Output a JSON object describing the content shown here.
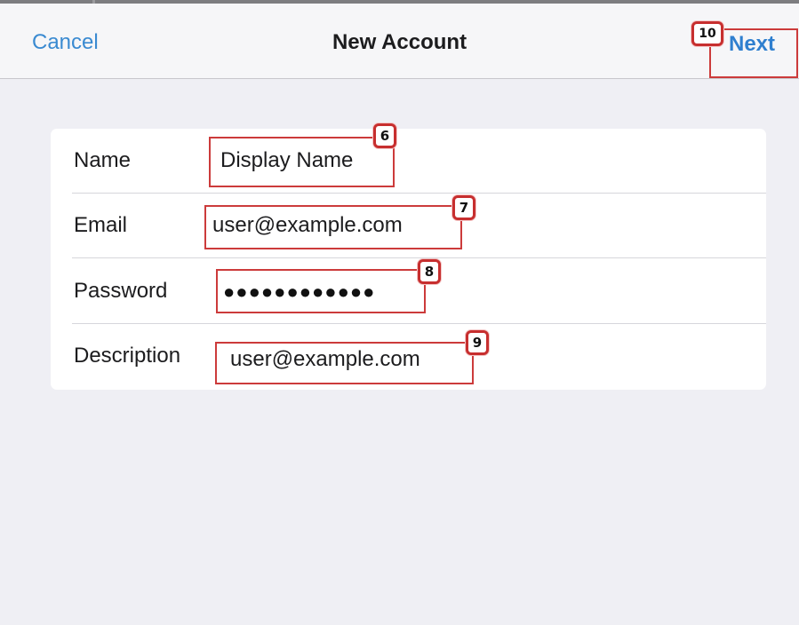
{
  "navbar": {
    "cancel_label": "Cancel",
    "title": "New Account",
    "next_label": "Next"
  },
  "form": {
    "rows": [
      {
        "label": "Name",
        "value": "Display Name"
      },
      {
        "label": "Email",
        "value": "user@example.com"
      },
      {
        "label": "Password",
        "value": "●●●●●●●●●●●●"
      },
      {
        "label": "Description",
        "value": "user@example.com"
      }
    ]
  },
  "callouts": {
    "name": "6",
    "email": "7",
    "password": "8",
    "description": "9",
    "next": "10"
  },
  "colors": {
    "accent": "#3a8ad1",
    "background": "#efeff4",
    "callout_red": "#cc3b3b"
  }
}
